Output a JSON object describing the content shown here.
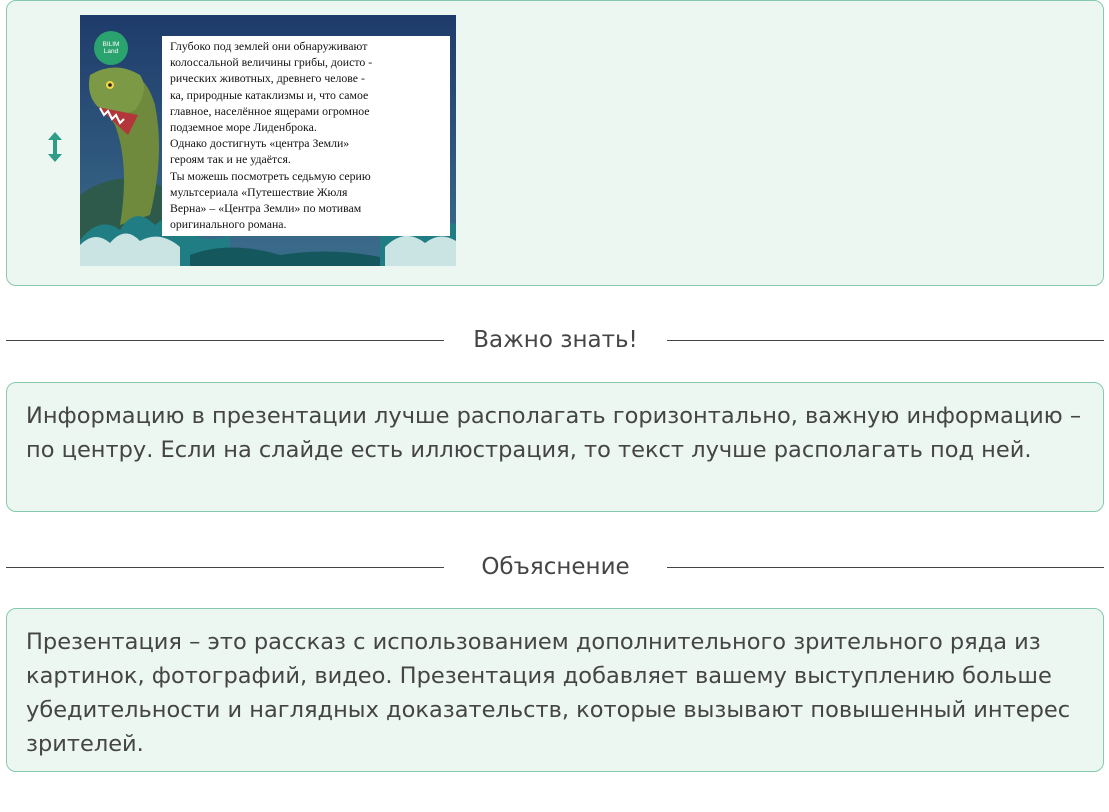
{
  "slide": {
    "logo_line1": "BILIM",
    "logo_line2": "Land",
    "text": "Глубоко под землей они обнаруживают\nколоссальной величины грибы, доисто       -\nрических животных, древнего челове        -\nка, природные катаклизмы и, что самое\nглавное, населённое ящерами огромное\nподземное море Лиденброка.\n Однако достигнуть «центра Земли»\nгероям так и не удаётся.\nТы можешь посмотреть седьмую серию\nмультсериала «Путешествие Жюля\nВерна» – «Центра Земли» по мотивам\nоригинального романа."
  },
  "important": {
    "heading": "Важно знать!",
    "text": "Информацию в презентации лучше располагать горизонтально, важную информацию – по центру. Если на слайде есть иллюстрация, то текст лучше располагать под ней."
  },
  "explanation": {
    "heading": "Объяснение",
    "text": "Презентация – это рассказ с использованием дополнительного зрительного ряда из картинок, фотографий, видео. Презентация добавляет вашему выступлению больше убедительности и наглядных доказательств, которые вызывают повышенный интерес зрителей."
  },
  "icons": {
    "drag_handle": "vertical-resize-arrow-icon"
  },
  "colors": {
    "card_background": "#ecf7f2",
    "card_border": "#86c9ad",
    "accent": "#2e9c86"
  }
}
